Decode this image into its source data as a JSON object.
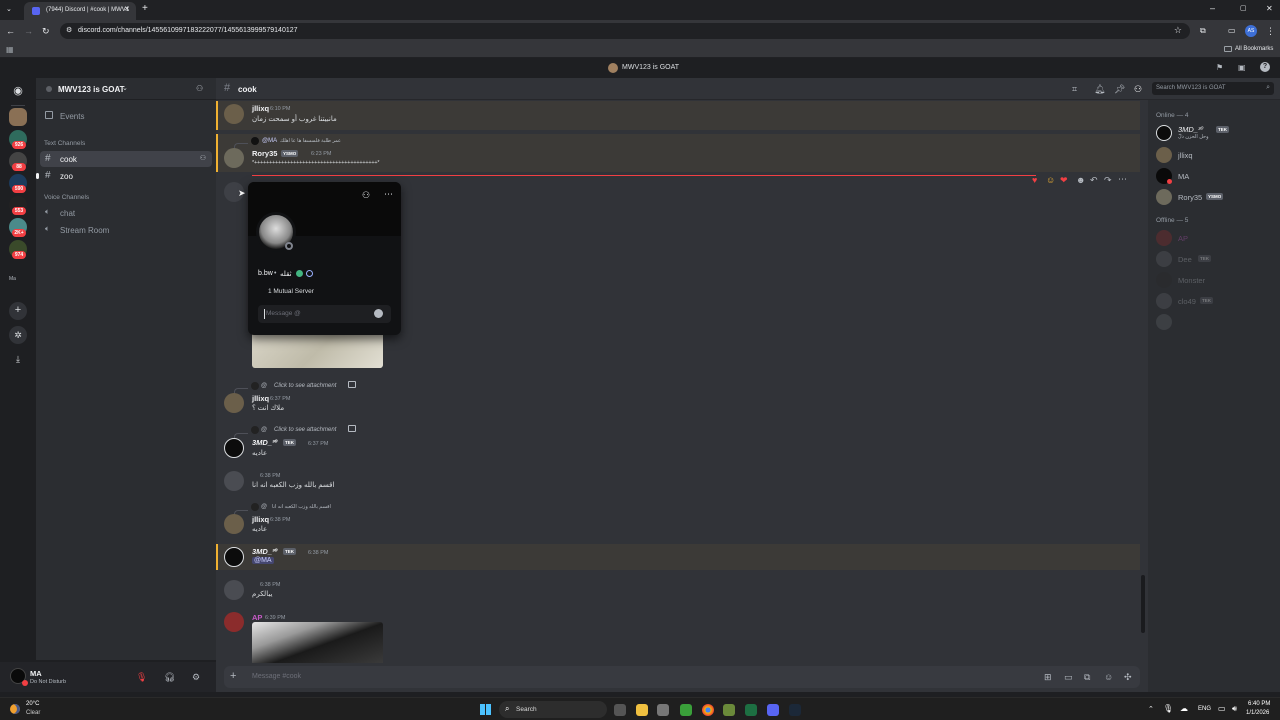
{
  "browser": {
    "tab_title": "(7944) Discord | #cook | MWV1",
    "url": "discord.com/channels/1455610997183222077/1455613999579140127",
    "bookmarks_label": "All Bookmarks",
    "profile_initials": "AS"
  },
  "discord": {
    "window_title": "MWV123 is GOAT",
    "server_name": "MWV123 is GOAT",
    "guild_badges": [
      "926",
      "88",
      "590",
      "553",
      "2K+",
      "974"
    ],
    "guild_folder_label": "Ma",
    "channels": {
      "events_label": "Events",
      "text_category": "Text Channels",
      "text_channels": [
        {
          "name": "cook"
        },
        {
          "name": "zoo"
        }
      ],
      "voice_category": "Voice Channels",
      "voice_channels": [
        {
          "name": "chat"
        },
        {
          "name": "Stream Room"
        }
      ]
    },
    "user_panel": {
      "name": "MA",
      "status": "Do Not Disturb"
    },
    "chat": {
      "channel_name": "cook",
      "search_placeholder": "Search MWV123 is GOAT",
      "composer_placeholder": "Message #cook",
      "messages": [
        {
          "author": "jllixq",
          "time": "6:10 PM",
          "text": "مانبيتنا غروب أو سمحت زمان"
        },
        {
          "reply_to": "@MA",
          "reply_text": "عمر طلبة فلسسفا ها عا اهلك",
          "author": "Rory35",
          "tag": "YSMO",
          "time": "6:23 PM",
          "text": "*+++++++++++++++++++++++++++++++++++++++++*"
        },
        {
          "reply_text": "Click to see attachment",
          "author": "jllixq",
          "time": "6:37 PM",
          "text": "ملاك انت ؟"
        },
        {
          "reply_text": "Click to see attachment",
          "author": "3MD_³⁰",
          "tag": "TEK",
          "time": "6:37 PM",
          "text": "عاديه"
        },
        {
          "time": "6:38 PM",
          "text": "اقسم بالله وزب الكعبه انه انا"
        },
        {
          "reply_text": "اقسم بالله وزب الكعبه انه انا",
          "author": "jllixq",
          "time": "6:38 PM",
          "text": "عاديه"
        },
        {
          "author": "3MD_³⁰",
          "tag": "TEK",
          "time": "6:38 PM",
          "text": "@MA"
        },
        {
          "time": "6:38 PM",
          "text": "يبالكرم"
        },
        {
          "author": "AP",
          "time": "6:39 PM",
          "text": ""
        }
      ]
    },
    "popout": {
      "username": "b.bw",
      "display": "ثقله",
      "mutual": "1 Mutual Server",
      "message_placeholder": "Message @"
    },
    "members": {
      "online_header": "Online — 4",
      "online": [
        {
          "name": "3MD_³⁰",
          "tag": "TEK",
          "sub": "وحل الحزن دلّ"
        },
        {
          "name": "jllixq"
        },
        {
          "name": "MA"
        },
        {
          "name": "Rory35",
          "tag": "YSMO"
        }
      ],
      "offline_header": "Offline — 5",
      "offline": [
        {
          "name": "AP"
        },
        {
          "name": "Dee",
          "tag": "TEK"
        },
        {
          "name": "Monster"
        },
        {
          "name": "clo49",
          "tag": "TEK"
        },
        {
          "name": ""
        }
      ]
    }
  },
  "taskbar": {
    "weather_temp": "20°C",
    "weather_desc": "Clear",
    "search_label": "Search",
    "lang": "ENG",
    "time": "6:40 PM",
    "date": "1/1/2026"
  }
}
